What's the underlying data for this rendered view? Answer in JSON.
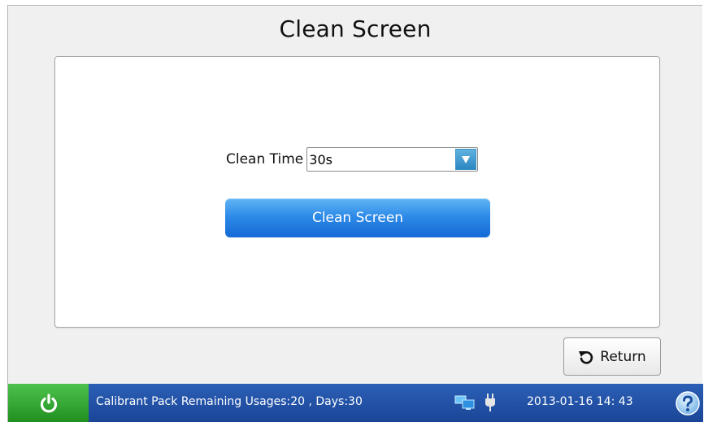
{
  "page": {
    "title": "Clean Screen"
  },
  "form": {
    "clean_time_label": "Clean Time",
    "clean_time_value": "30s",
    "clean_button_label": "Clean Screen"
  },
  "actions": {
    "return_label": "Return"
  },
  "status_bar": {
    "message": "Calibrant Pack Remaining Usages:20 , Days:30",
    "datetime": "2013-01-16  14: 43",
    "icons": [
      "power-icon",
      "network-icon",
      "plug-icon",
      "help-icon"
    ]
  },
  "colors": {
    "status_bar": "#1f4fa6",
    "power_button": "#2fa82f",
    "primary_button": "#2e8be8"
  }
}
